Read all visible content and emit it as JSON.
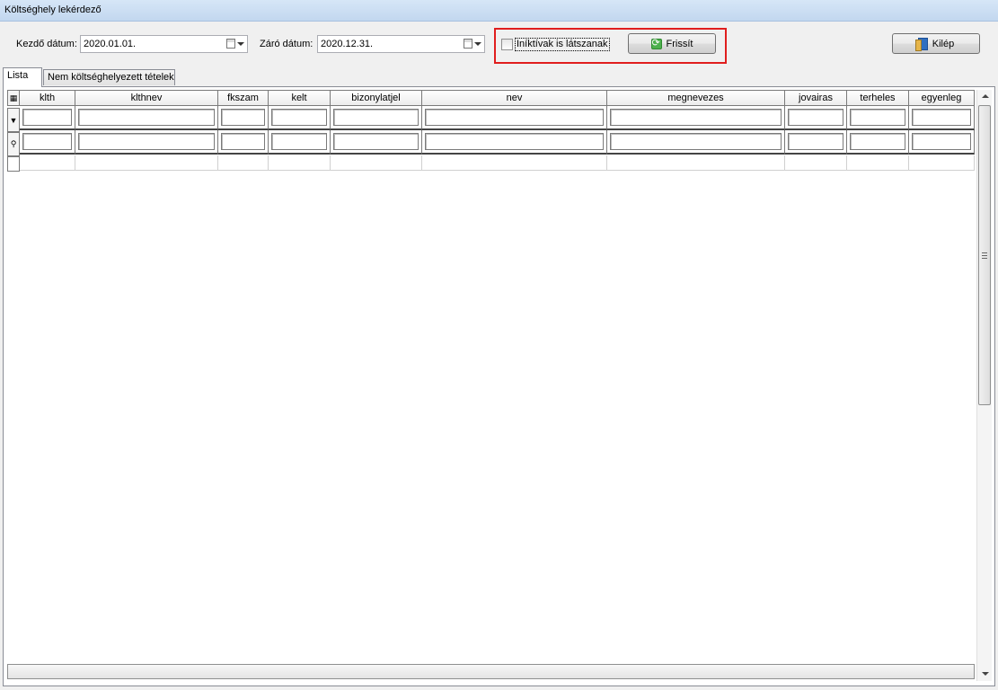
{
  "window": {
    "title": "Költséghely lekérdező"
  },
  "toolbar": {
    "start_label": "Kezdő dátum:",
    "start_value": "2020.01.01.",
    "end_label": "Záró dátum:",
    "end_value": "2020.12.31.",
    "inactive_label": "Iníktívak is látszanak",
    "inactive_checked": false,
    "refresh_label": "Frissít",
    "exit_label": "Kilép"
  },
  "tabs": [
    {
      "label": "Lista",
      "active": true
    },
    {
      "label": "Nem költséghelyezett tételek",
      "active": false
    }
  ],
  "grid": {
    "columns": [
      "klth",
      "klthnev",
      "fkszam",
      "kelt",
      "bizonylatjel",
      "nev",
      "megnevezes",
      "jovairas",
      "terheles",
      "egyenleg"
    ]
  },
  "colors": {
    "highlight": "#e01e1e"
  }
}
